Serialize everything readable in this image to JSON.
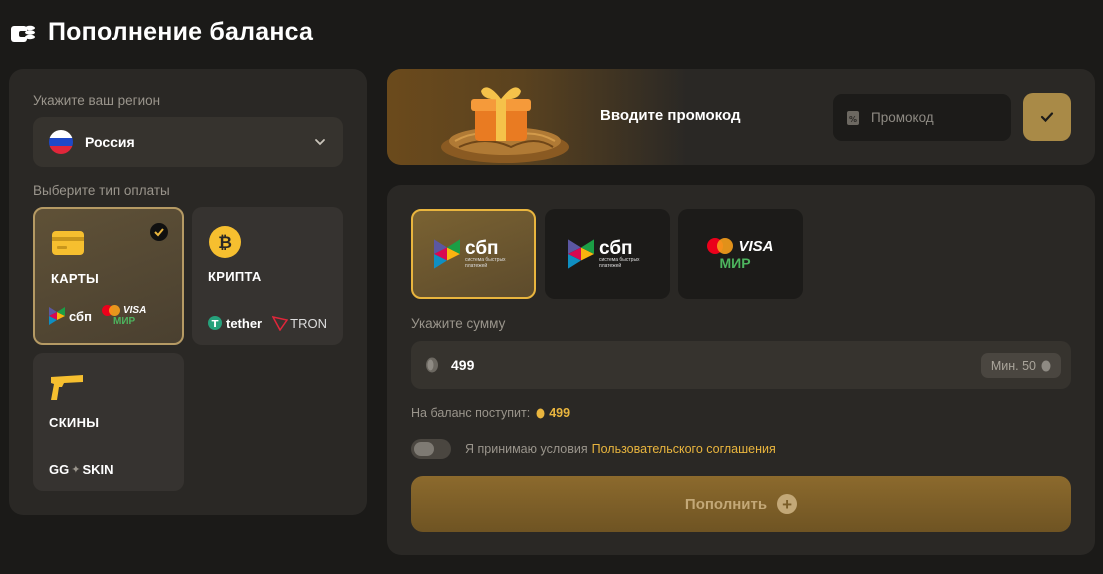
{
  "page": {
    "title": "Пополнение баланса",
    "title_icon": "wallet-coins-icon"
  },
  "region": {
    "label": "Укажите ваш регион",
    "value": "Россия",
    "flag": "russia-flag-icon"
  },
  "payment_type": {
    "label": "Выберите тип оплаты",
    "options": [
      {
        "id": "cards",
        "name": "КАРТЫ",
        "icon": "credit-card-icon",
        "selected": true,
        "logos": [
          "сбп",
          "VISA",
          "МИР"
        ],
        "sbp_caption": "система быстрых платежей"
      },
      {
        "id": "crypto",
        "name": "КРИПТА",
        "icon": "bitcoin-icon",
        "selected": false,
        "logos": [
          "tether",
          "TRON"
        ]
      },
      {
        "id": "skins",
        "name": "СКИНЫ",
        "icon": "pistol-icon",
        "selected": false,
        "logos": [
          "GG",
          "SKIN"
        ]
      }
    ]
  },
  "promo": {
    "title": "Вводите промокод",
    "placeholder": "Промокод",
    "button_icon": "checkmark-icon"
  },
  "methods": [
    {
      "id": "sbp-1",
      "brand": "сбп",
      "caption": "система быстрых платежей",
      "selected": true
    },
    {
      "id": "sbp-2",
      "brand": "сбп",
      "caption": "система быстрых платежей",
      "selected": false
    },
    {
      "id": "cards",
      "visa": "VISA",
      "mir": "МИР",
      "selected": false
    }
  ],
  "amount": {
    "label": "Укажите сумму",
    "value": "499",
    "min_label": "Мин. 50"
  },
  "receive": {
    "label": "На баланс поступит:",
    "value": "499"
  },
  "terms": {
    "text": "Я принимаю условия",
    "link": "Пользовательского соглашения",
    "accepted": false
  },
  "submit": {
    "label": "Пополнить",
    "icon": "plus-circle-icon"
  },
  "colors": {
    "accent": "#e9b53e",
    "panel": "#2a2825",
    "background": "#1b1a18",
    "button": "#8c6a2d"
  }
}
